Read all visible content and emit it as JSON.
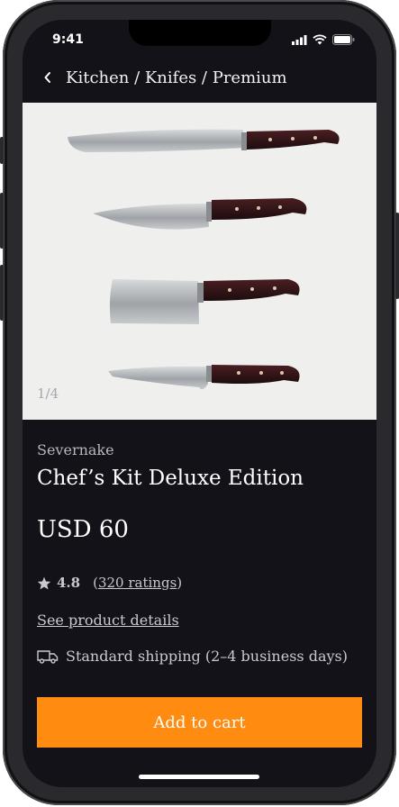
{
  "status_bar": {
    "time": "9:41"
  },
  "nav": {
    "breadcrumb": "Kitchen / Knifes / Premium"
  },
  "gallery": {
    "counter": "1/4"
  },
  "product": {
    "brand": "Severnake",
    "title": "Chef’s Kit Deluxe Edition",
    "price": "USD 60",
    "rating": "4.8",
    "ratings_link": "320 ratings",
    "ratings_open": "(",
    "ratings_close": ")",
    "details_link": "See product details",
    "shipping": "Standard shipping (2–4 business days)"
  },
  "actions": {
    "add_to_cart": "Add to cart"
  },
  "colors": {
    "accent": "#ff8c10",
    "background": "#131219",
    "hero_bg": "#efefee"
  }
}
